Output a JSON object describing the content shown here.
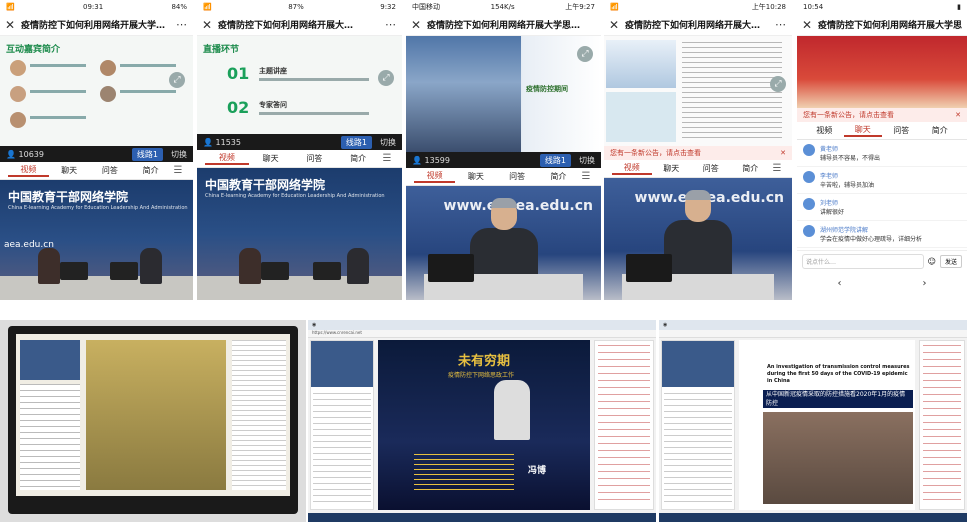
{
  "p1": {
    "status_time": "09:31",
    "status_batt": "84%",
    "title": "疫情防控下如何利用网络开展大学…",
    "slide_heading": "互动嘉宾简介",
    "viewers": "10639",
    "line_label": "线路1",
    "switch_label": "切换",
    "tabs": [
      "视频",
      "聊天",
      "问答",
      "简介"
    ],
    "studio_brand": "中国教育干部网络学院",
    "studio_brand_en": "China E-learning Academy for Education Leadership And Administration",
    "site_text": "aea.edu.cn"
  },
  "p2": {
    "status_time": "9:32",
    "status_batt": "87%",
    "title": "疫情防控下如何利用网络开展大…",
    "slide_heading": "直播环节",
    "item1_num": "01",
    "item1_label": "主题讲座",
    "item2_num": "02",
    "item2_label": "专家答问",
    "viewers": "11535",
    "line_label": "线路1",
    "switch_label": "切换",
    "tabs": [
      "视频",
      "聊天",
      "问答",
      "简介"
    ],
    "studio_brand": "中国教育干部网络学院",
    "studio_brand_en": "China E-learning Academy for Education Leadership And Administration"
  },
  "p3": {
    "status_left": "中国移动",
    "status_speed": "154K/s",
    "status_time": "上午9:27",
    "title": "疫情防控下如何利用网络开展大学思…",
    "slide_text": "疫情防控期间",
    "viewers": "13599",
    "line_label": "线路1",
    "switch_label": "切换",
    "tabs": [
      "视频",
      "聊天",
      "问答",
      "简介"
    ],
    "studio_brand": "www.enaea.edu.cn"
  },
  "p4": {
    "status_time": "上午10:28",
    "title": "疫情防控下如何利用网络开展大…",
    "notice": "您有一条新公告，请点击查看",
    "tabs": [
      "视频",
      "聊天",
      "问答",
      "简介"
    ],
    "studio_brand": "www.enaea.edu.cn"
  },
  "p5": {
    "status_time": "10:54",
    "title": "疫情防控下如何利用网络开展大学思",
    "notice": "您有一条新公告，请点击查看",
    "tabs": [
      "视频",
      "聊天",
      "问答",
      "简介"
    ],
    "chats": [
      {
        "name": "黄老师",
        "text": "辅导员不容易，不得出"
      },
      {
        "name": "李老师",
        "text": "辛苦啦，辅导员加油"
      },
      {
        "name": "刘老师",
        "text": "讲解很好"
      },
      {
        "name": "湖州师范学院讲解",
        "text": "学会在疫情中做好心理疏导，详细分析"
      }
    ],
    "input_placeholder": "说点什么…",
    "send_label": "发送"
  },
  "p6": {
    "label": "monitor-photo"
  },
  "p7": {
    "slide_title": "未有穷期",
    "slide_subtitle": "疫情防控下网络思政工作",
    "slide_name": "冯博",
    "url": "https://www.cnrencai.net"
  },
  "p8": {
    "doc_title": "An investigation of transmission control measures during the first 50 days of the COVID-19 epidemic in China",
    "doc_cn": "从中国新冠疫情采取的防控措施看2020年1月的疫情防控"
  }
}
